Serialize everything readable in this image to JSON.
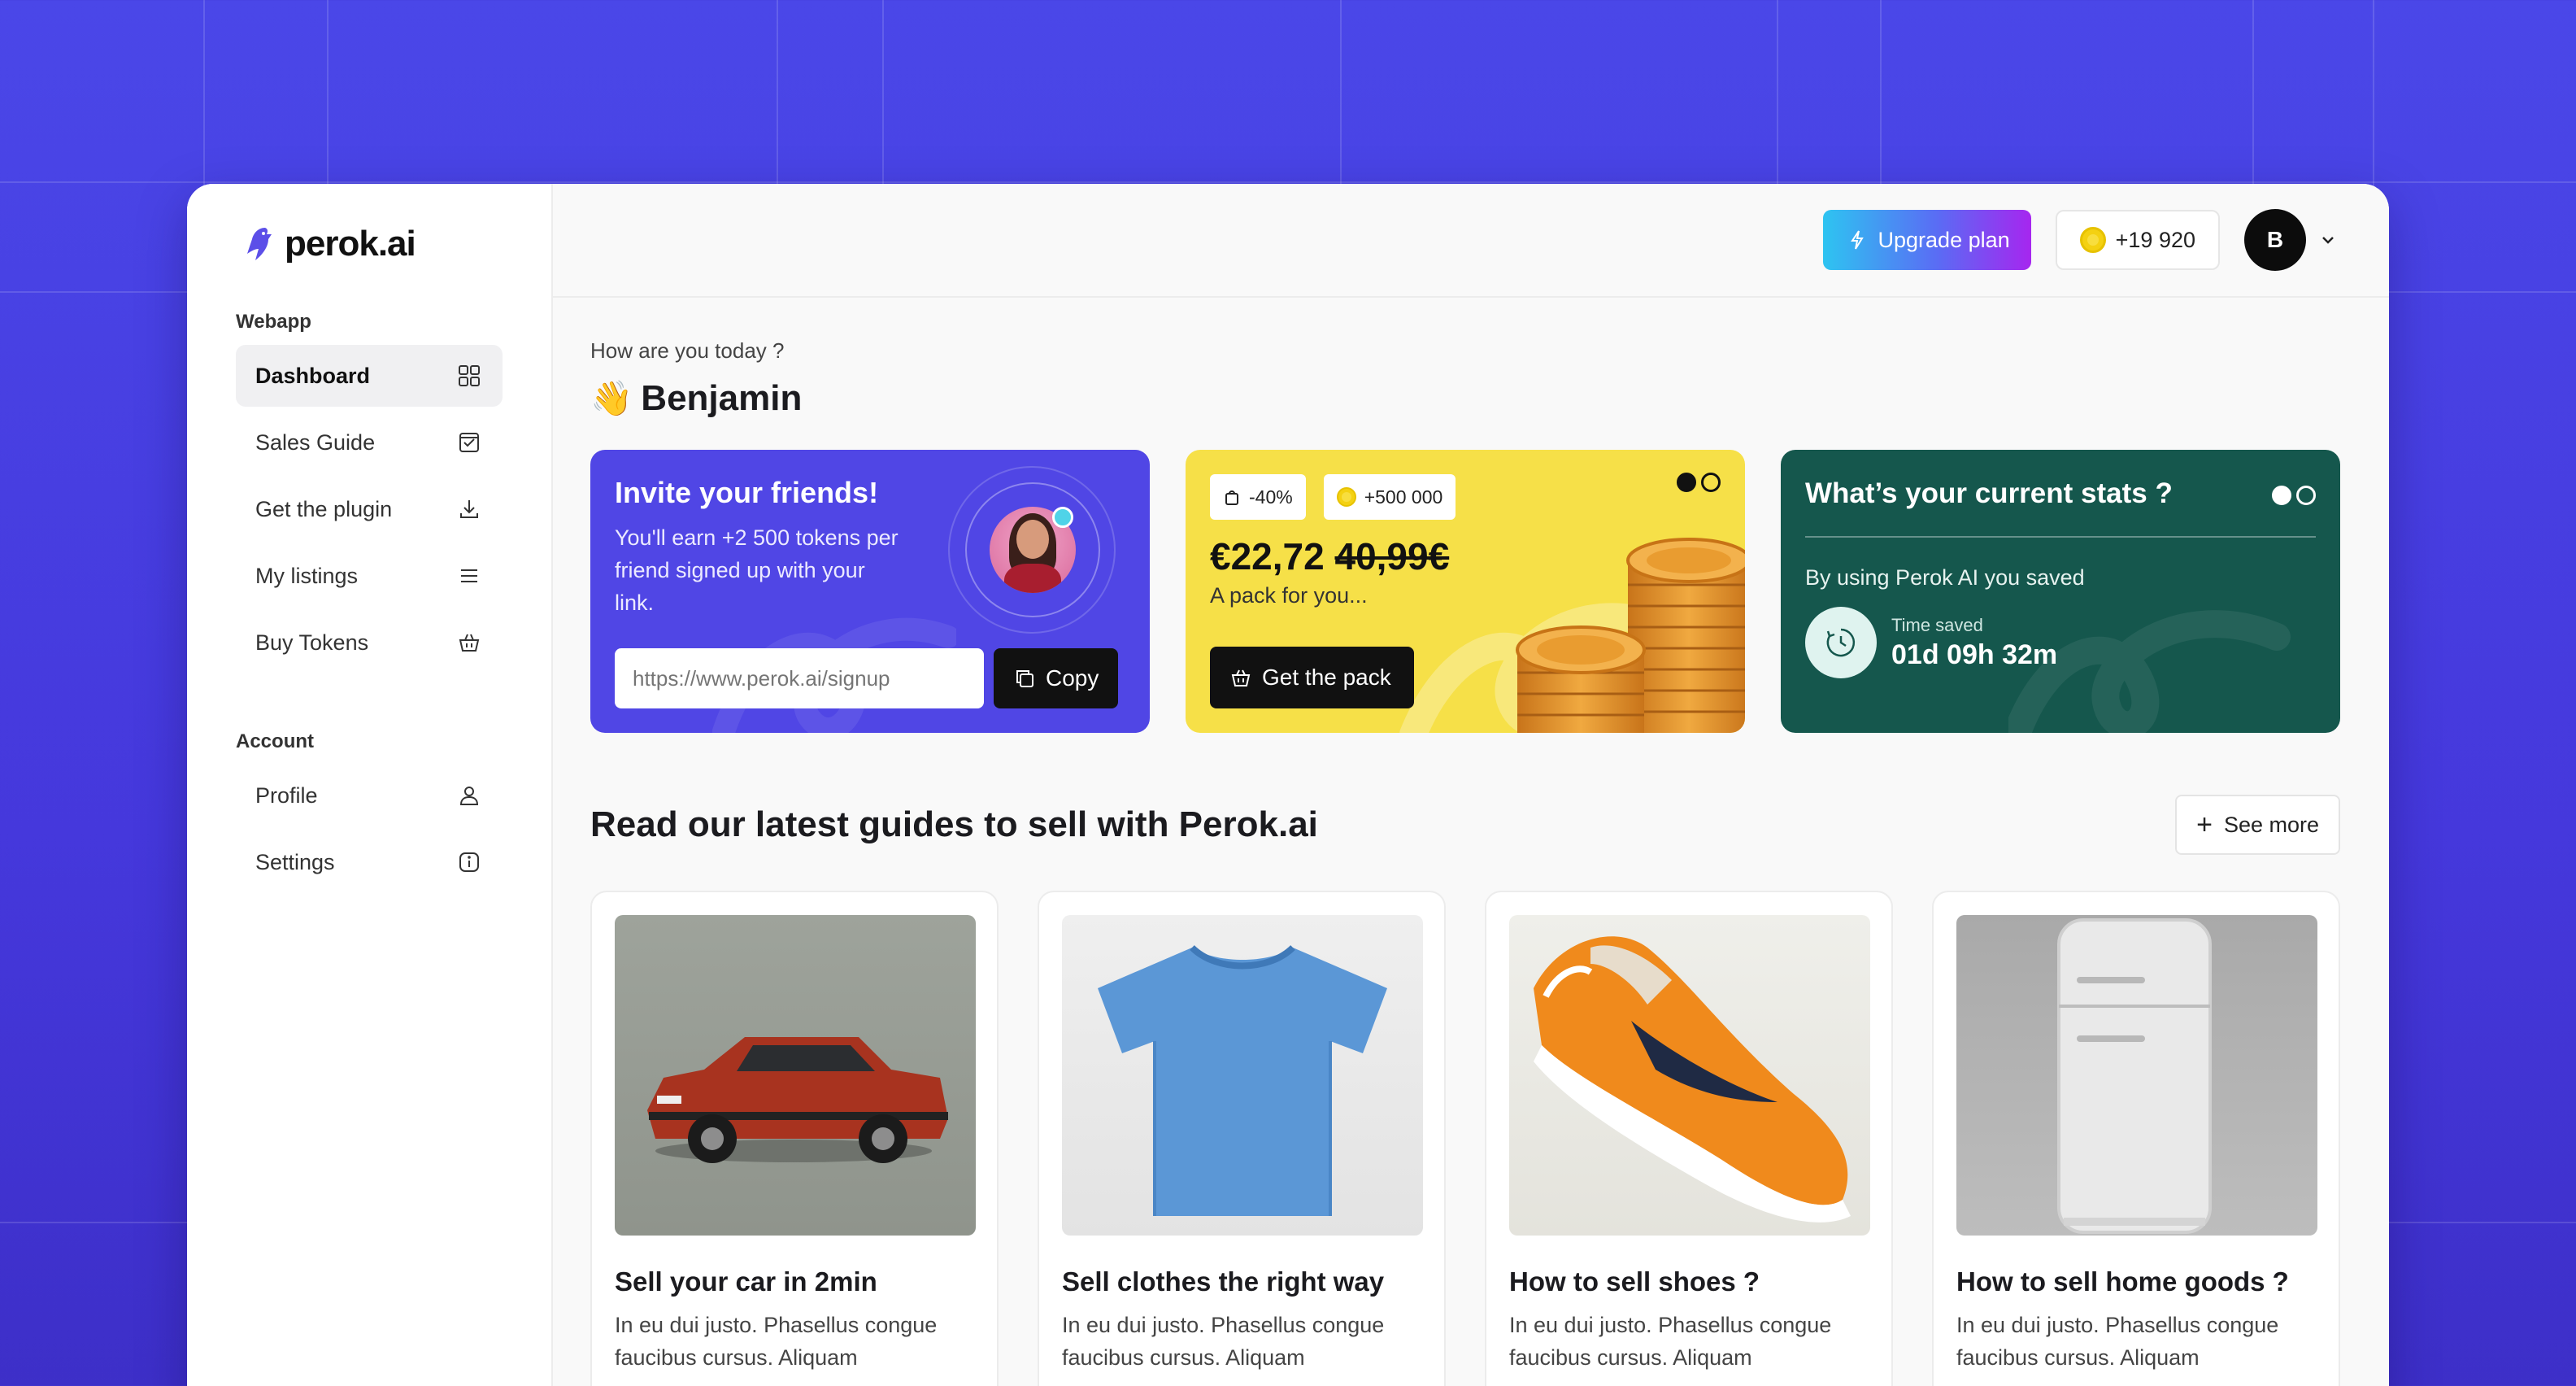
{
  "brand": {
    "name": "perok.ai"
  },
  "sidebar": {
    "sections": [
      {
        "label": "Webapp"
      },
      {
        "label": "Account"
      }
    ],
    "webapp_items": [
      {
        "label": "Dashboard",
        "icon": "grid-icon",
        "active": true
      },
      {
        "label": "Sales Guide",
        "icon": "checklist-icon"
      },
      {
        "label": "Get the plugin",
        "icon": "download-icon"
      },
      {
        "label": "My listings",
        "icon": "menu-lines-icon"
      },
      {
        "label": "Buy Tokens",
        "icon": "basket-icon"
      }
    ],
    "account_items": [
      {
        "label": "Profile",
        "icon": "user-icon"
      },
      {
        "label": "Settings",
        "icon": "info-icon"
      }
    ]
  },
  "topbar": {
    "upgrade_label": "Upgrade plan",
    "tokens": "+19 920",
    "avatar_initial": "B"
  },
  "greeting": {
    "subtitle": "How are you today ?",
    "emoji": "👋",
    "name": "Benjamin"
  },
  "invite_card": {
    "title": "Invite your friends!",
    "body": "You'll earn +2 500 tokens per friend signed up with your link.",
    "link_placeholder": "https://www.perok.ai/signup",
    "copy_label": "Copy",
    "color": "#5046e5"
  },
  "pack_card": {
    "badge_discount": "-40%",
    "badge_tokens": "+500 000",
    "price_new": "€22,72",
    "price_old": "40,99€",
    "subtitle": "A pack for you...",
    "button_label": "Get the pack",
    "color": "#f6e048"
  },
  "stats_card": {
    "title": "What’s your current stats ?",
    "subtitle": "By using Perok AI you saved",
    "metric_label": "Time saved",
    "metric_value": "01d 09h 32m",
    "color": "#15574d"
  },
  "guides": {
    "title": "Read our latest guides to sell with Perok.ai",
    "see_more_label": "See more",
    "items": [
      {
        "title": "Sell your car in 2min",
        "desc": "In eu dui justo. Phasellus congue faucibus cursus. Aliquam",
        "image": "red-car"
      },
      {
        "title": "Sell clothes the right way",
        "desc": "In eu dui justo. Phasellus congue faucibus cursus. Aliquam",
        "image": "blue-tshirt"
      },
      {
        "title": "How to sell shoes ?",
        "desc": "In eu dui justo. Phasellus congue faucibus cursus. Aliquam",
        "image": "orange-sneaker"
      },
      {
        "title": "How to sell home goods ?",
        "desc": "In eu dui justo. Phasellus congue faucibus cursus. Aliquam",
        "image": "white-fridge"
      }
    ]
  }
}
